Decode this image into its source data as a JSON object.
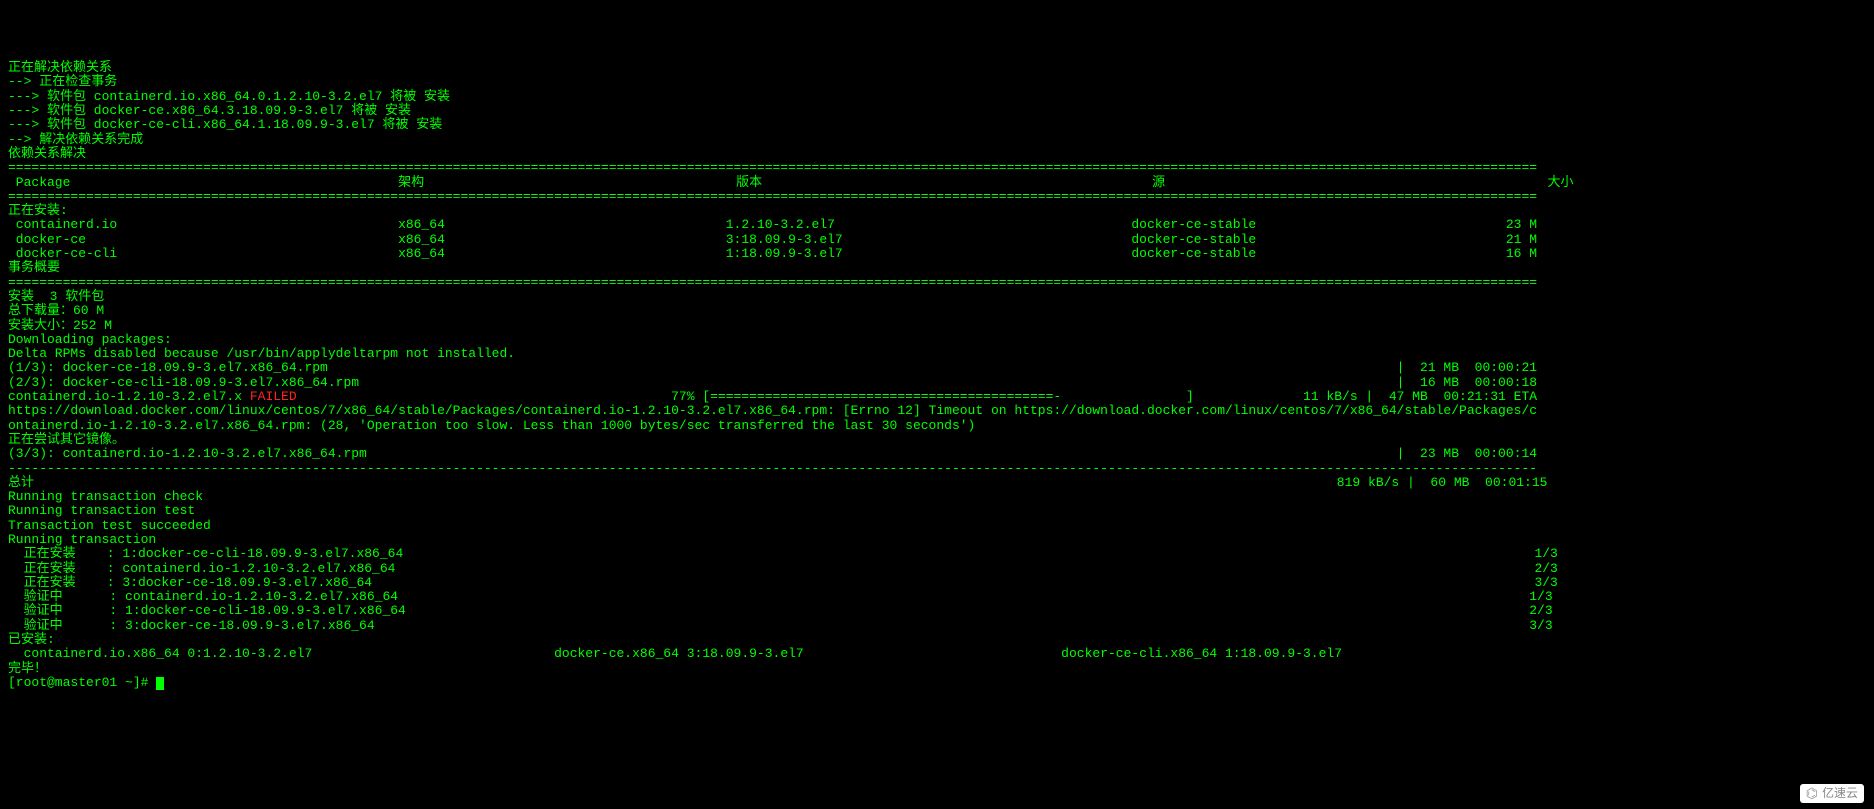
{
  "header": {
    "l1": "正在解决依赖关系",
    "l2": "--> 正在检查事务",
    "l3": "---> 软件包 containerd.io.x86_64.0.1.2.10-3.2.el7 将被 安装",
    "l4": "---> 软件包 docker-ce.x86_64.3.18.09.9-3.el7 将被 安装",
    "l5": "---> 软件包 docker-ce-cli.x86_64.1.18.09.9-3.el7 将被 安装",
    "l6": "--> 解决依赖关系完成",
    "l7": "",
    "l8": "依赖关系解决",
    "l9": ""
  },
  "table": {
    "hdr_package": " Package",
    "hdr_arch": "架构",
    "hdr_version": "版本",
    "hdr_repo": "源",
    "hdr_size": "大小",
    "installing": "正在安装:",
    "rows": [
      {
        "pkg": " containerd.io",
        "arch": "x86_64",
        "ver": "1.2.10-3.2.el7",
        "repo": "docker-ce-stable",
        "size": "23 M"
      },
      {
        "pkg": " docker-ce",
        "arch": "x86_64",
        "ver": "3:18.09.9-3.el7",
        "repo": "docker-ce-stable",
        "size": "21 M"
      },
      {
        "pkg": " docker-ce-cli",
        "arch": "x86_64",
        "ver": "1:18.09.9-3.el7",
        "repo": "docker-ce-stable",
        "size": "16 M"
      }
    ],
    "summary_title": "事务概要"
  },
  "summary": {
    "install_count": "安装  3 软件包",
    "blank": "",
    "total_dl": "总下载量：60 M",
    "install_size": "安装大小：252 M",
    "downloading": "Downloading packages:",
    "delta": "Delta RPMs disabled because /usr/bin/applydeltarpm not installed."
  },
  "downloads": {
    "d1_left": "(1/3): docker-ce-18.09.9-3.el7.x86_64.rpm",
    "d1_right": "|  21 MB  00:00:21",
    "d2_left": "(2/3): docker-ce-cli-18.09.9-3.el7.x86_64.rpm",
    "d2_right": "|  16 MB  00:00:18",
    "fail_left": "containerd.io-1.2.10-3.2.el7.x ",
    "fail_word": "FAILED",
    "fail_pct": "77%",
    "fail_bar": "[============================================-                ]",
    "fail_right": "  11 kB/s |  47 MB  00:21:31 ETA",
    "url_line": "https://download.docker.com/linux/centos/7/x86_64/stable/Packages/containerd.io-1.2.10-3.2.el7.x86_64.rpm: [Errno 12] Timeout on https://download.docker.com/linux/centos/7/x86_64/stable/Packages/containerd.io-1.2.10-3.2.el7.x86_64.rpm: (28, 'Operation too slow. Less than 1000 bytes/sec transferred the last 30 seconds')",
    "retry": "正在尝试其它镜像。",
    "d3_left": "(3/3): containerd.io-1.2.10-3.2.el7.x86_64.rpm",
    "d3_right": "|  23 MB  00:00:14"
  },
  "totals": {
    "label": "总计",
    "right": "819 kB/s |  60 MB  00:01:15"
  },
  "trans": {
    "t1": "Running transaction check",
    "t2": "Running transaction test",
    "t3": "Transaction test succeeded",
    "t4": "Running transaction",
    "steps": [
      {
        "left": "  正在安装    : 1:docker-ce-cli-18.09.9-3.el7.x86_64",
        "right": "1/3"
      },
      {
        "left": "  正在安装    : containerd.io-1.2.10-3.2.el7.x86_64",
        "right": "2/3"
      },
      {
        "left": "  正在安装    : 3:docker-ce-18.09.9-3.el7.x86_64",
        "right": "3/3"
      },
      {
        "left": "  验证中      : containerd.io-1.2.10-3.2.el7.x86_64",
        "right": "1/3"
      },
      {
        "left": "  验证中      : 1:docker-ce-cli-18.09.9-3.el7.x86_64",
        "right": "2/3"
      },
      {
        "left": "  验证中      : 3:docker-ce-18.09.9-3.el7.x86_64",
        "right": "3/3"
      }
    ]
  },
  "installed": {
    "title": "已安装:",
    "p1": "  containerd.io.x86_64 0:1.2.10-3.2.el7",
    "p2": "docker-ce.x86_64 3:18.09.9-3.el7",
    "p3": "docker-ce-cli.x86_64 1:18.09.9-3.el7"
  },
  "footer": {
    "done": "完毕！",
    "prompt_left": "[root@master01 ~]# "
  },
  "watermark": "亿速云"
}
